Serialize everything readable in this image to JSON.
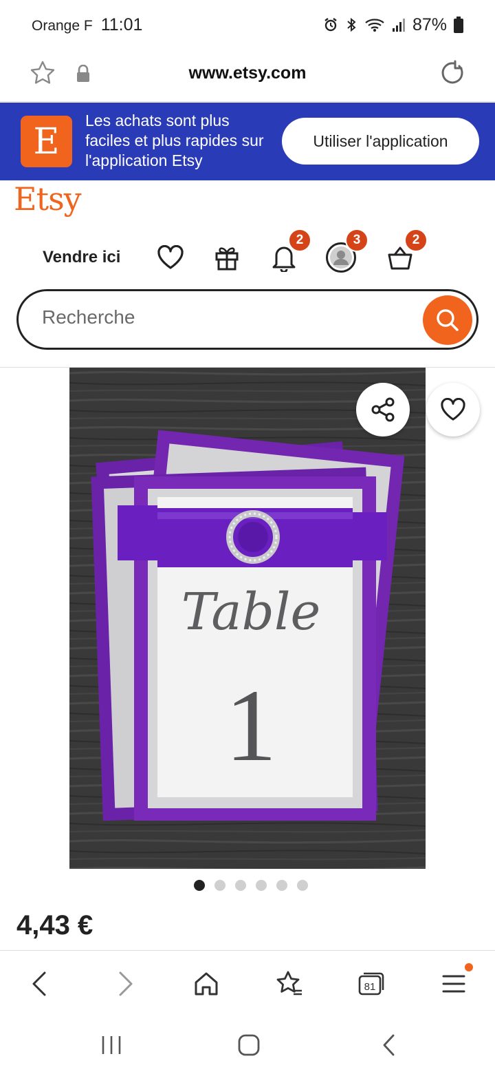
{
  "status_bar": {
    "carrier": "Orange F",
    "time": "11:01",
    "battery": "87%"
  },
  "browser": {
    "url": "www.etsy.com",
    "tab_count": "81"
  },
  "app_banner": {
    "message": "Les achats sont plus faciles et plus rapides sur l'application Etsy",
    "button_label": "Utiliser l'application",
    "logo_letter": "E"
  },
  "header": {
    "logo": "Etsy",
    "sell_label": "Vendre ici",
    "notifications_count": "2",
    "account_count": "3",
    "cart_count": "2"
  },
  "search": {
    "placeholder": "Recherche"
  },
  "product": {
    "image_text_title": "Table",
    "image_text_number": "1",
    "price": "4,43 €",
    "image_count": 6,
    "active_image": 0
  },
  "colors": {
    "etsy_orange": "#f1641e",
    "banner_blue": "#2a3bb7",
    "badge_red": "#d54418",
    "card_purple": "#6a22a8"
  }
}
